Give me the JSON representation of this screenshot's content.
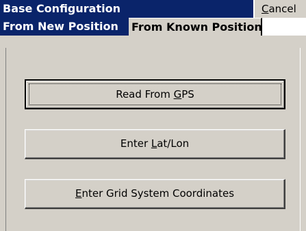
{
  "window": {
    "title": "Base Configuration",
    "cancel_label": "Cancel",
    "cancel_mnemonic": "C",
    "cancel_rest": "ancel"
  },
  "tabs": [
    {
      "label": "From New Position",
      "active": true
    },
    {
      "label": "From Known Position",
      "active": false
    }
  ],
  "buttons": [
    {
      "label": "Read From GPS",
      "pre": "Read From ",
      "mnemonic": "G",
      "post": "PS",
      "focused": true
    },
    {
      "label": "Enter Lat/Lon",
      "pre": "Enter ",
      "mnemonic": "L",
      "post": "at/Lon",
      "focused": false
    },
    {
      "label": "Enter Grid System Coordinates",
      "pre": "",
      "mnemonic": "E",
      "post": "nter Grid System Coordinates",
      "focused": false
    }
  ],
  "colors": {
    "titlebar": "#0a246a",
    "face": "#d4d0c8",
    "text_on_accent": "#ffffff"
  }
}
